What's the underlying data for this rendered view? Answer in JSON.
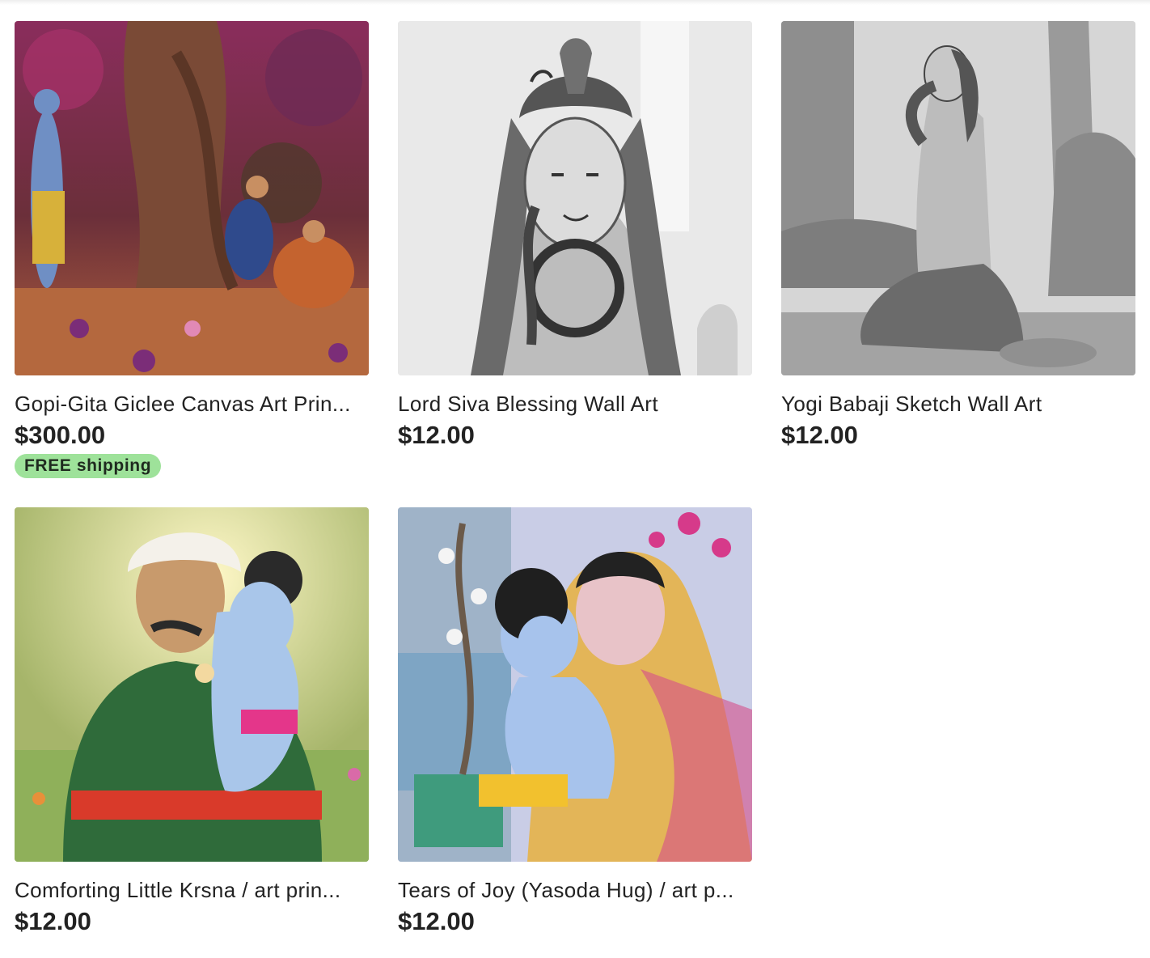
{
  "listings": [
    {
      "title": "Gopi-Gita Giclee Canvas Art Prin...",
      "price": "$300.00",
      "badge": "FREE shipping"
    },
    {
      "title": "Lord Siva Blessing Wall Art",
      "price": "$12.00"
    },
    {
      "title": "Yogi Babaji Sketch Wall Art",
      "price": "$12.00"
    },
    {
      "title": "Comforting Little Krsna / art prin...",
      "price": "$12.00"
    },
    {
      "title": "Tears of Joy (Yasoda Hug) / art p...",
      "price": "$12.00"
    }
  ],
  "colors": {
    "badge_bg": "#9ee29a",
    "text": "#222222"
  }
}
